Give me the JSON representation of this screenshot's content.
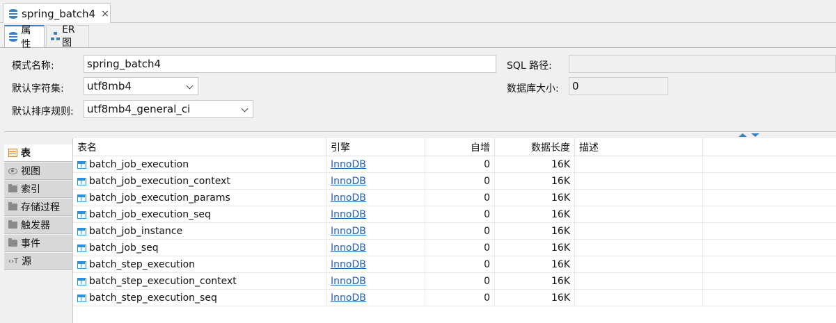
{
  "document_tab": {
    "title": "spring_batch4",
    "close": "×",
    "icon": "database-icon"
  },
  "sub_tabs": [
    {
      "label": "属性",
      "icon": "database-icon",
      "active": true
    },
    {
      "label": "ER 图",
      "icon": "er-diagram-icon",
      "active": false
    }
  ],
  "properties": {
    "schema_name_label": "模式名称:",
    "schema_name_value": "spring_batch4",
    "charset_label": "默认字符集:",
    "charset_value": "utf8mb4",
    "collation_label": "默认排序规则:",
    "collation_value": "utf8mb4_general_ci",
    "sql_path_label": "SQL 路径:",
    "sql_path_value": "",
    "db_size_label": "数据库大小:",
    "db_size_value": "0"
  },
  "side_nav": [
    {
      "label": "表",
      "icon": "table-icon",
      "active": true
    },
    {
      "label": "视图",
      "icon": "view-icon",
      "active": false
    },
    {
      "label": "索引",
      "icon": "folder-icon",
      "active": false
    },
    {
      "label": "存储过程",
      "icon": "folder-icon",
      "active": false
    },
    {
      "label": "触发器",
      "icon": "folder-icon",
      "active": false
    },
    {
      "label": "事件",
      "icon": "folder-icon",
      "active": false
    },
    {
      "label": "源",
      "icon": "source-icon",
      "active": false
    }
  ],
  "source_glyph": "‹›T",
  "table_grid": {
    "columns": [
      "表名",
      "引擎",
      "自增",
      "数据长度",
      "描述"
    ],
    "rows": [
      {
        "name": "batch_job_execution",
        "engine": "InnoDB",
        "auto_inc": "0",
        "data_length": "16K",
        "desc": ""
      },
      {
        "name": "batch_job_execution_context",
        "engine": "InnoDB",
        "auto_inc": "0",
        "data_length": "16K",
        "desc": ""
      },
      {
        "name": "batch_job_execution_params",
        "engine": "InnoDB",
        "auto_inc": "0",
        "data_length": "16K",
        "desc": ""
      },
      {
        "name": "batch_job_execution_seq",
        "engine": "InnoDB",
        "auto_inc": "0",
        "data_length": "16K",
        "desc": ""
      },
      {
        "name": "batch_job_instance",
        "engine": "InnoDB",
        "auto_inc": "0",
        "data_length": "16K",
        "desc": ""
      },
      {
        "name": "batch_job_seq",
        "engine": "InnoDB",
        "auto_inc": "0",
        "data_length": "16K",
        "desc": ""
      },
      {
        "name": "batch_step_execution",
        "engine": "InnoDB",
        "auto_inc": "0",
        "data_length": "16K",
        "desc": ""
      },
      {
        "name": "batch_step_execution_context",
        "engine": "InnoDB",
        "auto_inc": "0",
        "data_length": "16K",
        "desc": ""
      },
      {
        "name": "batch_step_execution_seq",
        "engine": "InnoDB",
        "auto_inc": "0",
        "data_length": "16K",
        "desc": ""
      }
    ]
  },
  "colors": {
    "accent": "#3d7fc0",
    "link": "#1f5fbf",
    "table_icon": "#2a8fd8",
    "active_nav_icon": "#e08020"
  }
}
